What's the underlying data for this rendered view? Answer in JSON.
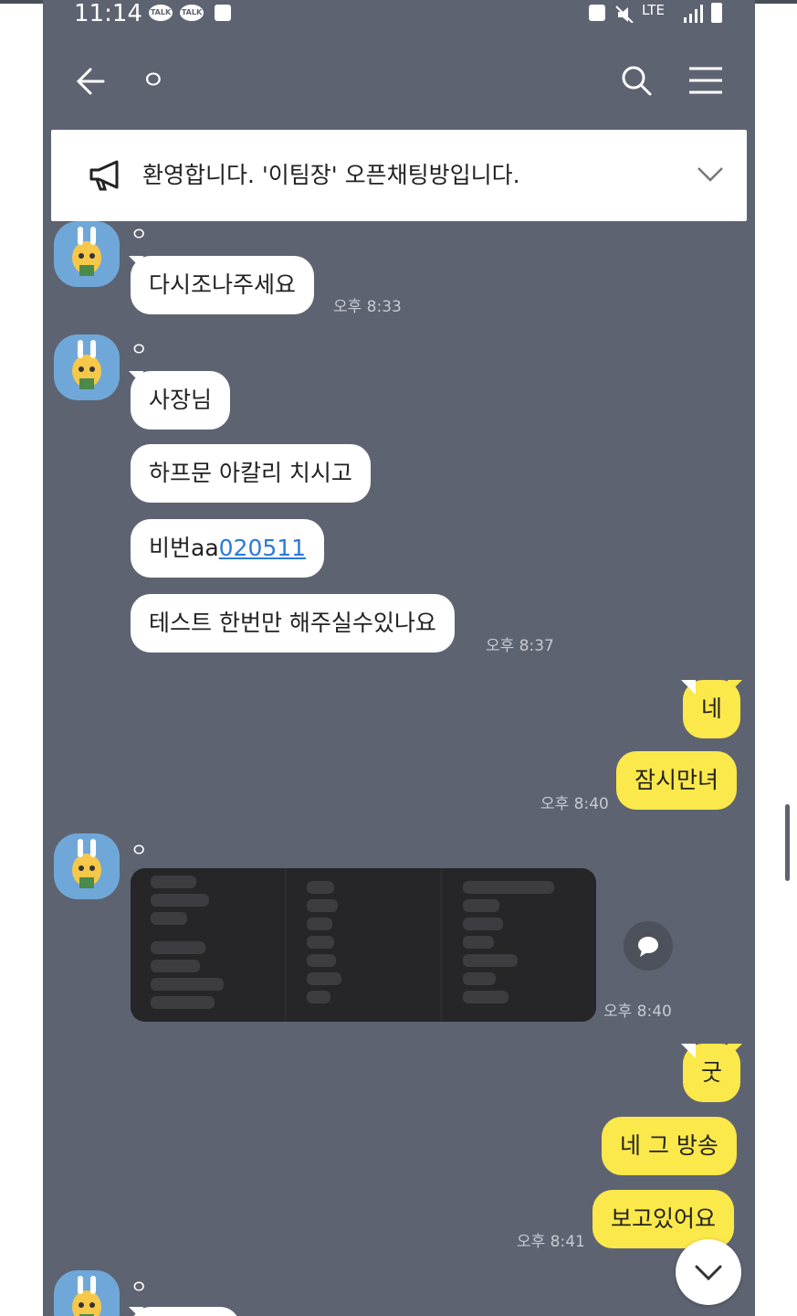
{
  "status_bar": {
    "time": "11:14",
    "notif_icons": [
      "talk-icon",
      "talk-icon",
      "app-icon"
    ],
    "right_icons": [
      "recycle-icon",
      "mute-icon",
      "lte-icon",
      "signal-icon",
      "battery-icon"
    ],
    "network": "LTE"
  },
  "header": {
    "title": "ㅇ",
    "back_icon": "arrow-left-icon",
    "search_icon": "search-icon",
    "menu_icon": "hamburger-menu-icon"
  },
  "notice": {
    "icon": "megaphone-icon",
    "text": "환영합니다. '이팀장' 오픈채팅방입니다.",
    "expand_icon": "chevron-down-icon"
  },
  "messages": [
    {
      "sender": "ㅇ",
      "bubbles": [
        "다시조나주세요"
      ],
      "time": "오후 8:33"
    },
    {
      "sender": "ㅇ",
      "bubbles": [
        "사장님",
        "하프문 아칼리 치시고",
        "비번aa",
        "테스트 한번만 해주실수있나요"
      ],
      "link_text": "020511",
      "time": "오후 8:37"
    },
    {
      "mine": true,
      "bubbles": [
        "네",
        "잠시만녀"
      ],
      "time": "오후 8:40"
    },
    {
      "sender": "ㅇ",
      "images": 3,
      "time": "오후 8:40"
    },
    {
      "mine": true,
      "bubbles": [
        "굿",
        "네 그 방송",
        "보고있어요"
      ],
      "time": "오후 8:41"
    },
    {
      "sender": "ㅇ"
    }
  ],
  "colors": {
    "background": "#5e6372",
    "my_bubble": "#fbe84a",
    "their_bubble": "#ffffff",
    "link": "#2b7ad9"
  }
}
